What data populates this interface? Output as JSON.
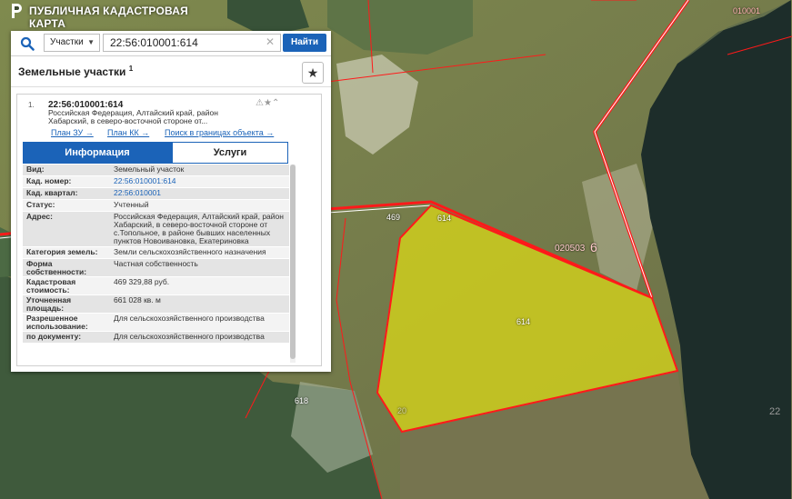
{
  "app": {
    "title": "ПУБЛИЧНАЯ КАДАСТРОВАЯ КАРТА",
    "logo_icon": "pkk-logo-icon"
  },
  "search": {
    "icon": "search-icon",
    "type_value": "Участки",
    "value": "22:56:010001:614",
    "clear_icon": "close-icon",
    "button_label": "Найти",
    "button_color": "#1b63b8"
  },
  "section": {
    "title": "Земельные участки",
    "count": "1",
    "star_icon": "star-icon"
  },
  "card": {
    "index": "1.",
    "cadnum": "22:56:010001:614",
    "address": "Российская Федерация, Алтайский край, район Хабарский, в северо-восточной стороне от...",
    "links": [
      "План ЗУ →",
      "План КК →",
      "Поиск в границах объекта →"
    ],
    "tabs": {
      "info": "Информация",
      "services": "Услуги"
    },
    "rows": [
      {
        "label": "Вид:",
        "value": "Земельный участок"
      },
      {
        "label": "Кад. номер:",
        "value": "22:56:010001:614"
      },
      {
        "label": "Кад. квартал:",
        "value": "22:56:010001"
      },
      {
        "label": "Статус:",
        "value": "Учтенный"
      },
      {
        "label": "Адрес:",
        "value": "Российская Федерация, Алтайский край, район Хабарский, в северо-восточной стороне от с.Топольное, в районе бывших населенных пунктов Новоивановка, Екатериновка"
      },
      {
        "label": "Категория земель:",
        "value": "Земли сельскохозяйственного назначения"
      },
      {
        "label": "Форма собственности:",
        "value": "Частная собственность"
      },
      {
        "label": "Кадастровая стоимость:",
        "value": "469 329,88 руб."
      },
      {
        "label": "Уточненная площадь:",
        "value": "661 028 кв. м"
      },
      {
        "label": "Разрешенное использование:",
        "value": "Для сельскохозяйственного производства"
      },
      {
        "label": "по документу:",
        "value": "Для сельскохозяйственного производства"
      }
    ]
  },
  "map": {
    "labels": {
      "block_top_right": "010001",
      "parcel_614": "614",
      "parcel_614_center": "614",
      "parcel_469": "469",
      "parcel_618": "618",
      "quarter": "020503",
      "quarter_digit": "6",
      "right_num": "22",
      "bottom_num": "20"
    },
    "colors": {
      "boundary": "#ff1a1a",
      "parcel_fill": "#d6d51a",
      "water": "#1d2d2a"
    }
  }
}
